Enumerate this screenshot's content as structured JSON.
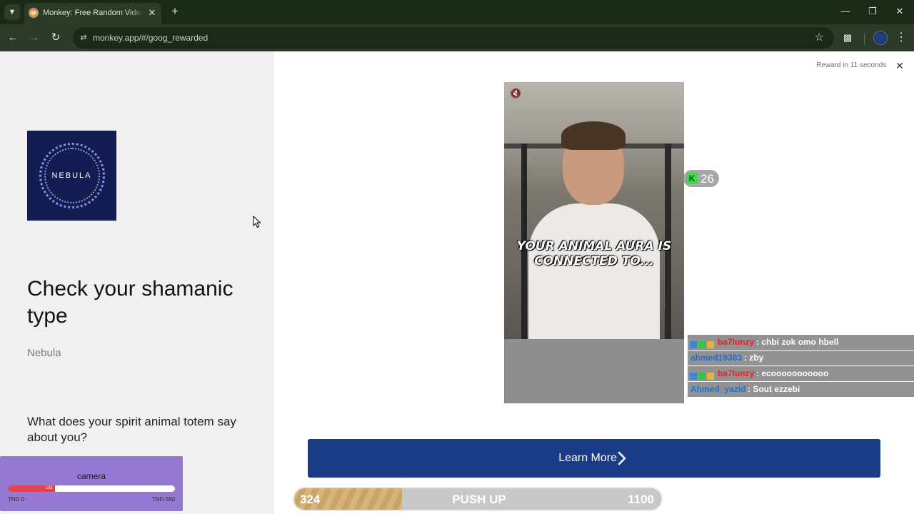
{
  "browser": {
    "tab_title": "Monkey: Free Random Video Chat",
    "url": "monkey.app/#/goog_rewarded"
  },
  "ad_sidebar": {
    "logo_word": "NEBULA",
    "headline": "Check your shamanic type",
    "brand": "Nebula",
    "question": "What does your spirit animal totem say about you?"
  },
  "camera_widget": {
    "title": "camera",
    "current_value": "151",
    "fill_fraction": 0.28,
    "min_label": "TND 0",
    "max_label": "TND 550"
  },
  "ad": {
    "reward_timer": "Reward in 11 seconds",
    "video_caption": "YOUR ANIMAL AURA IS CONNECTED TO...",
    "learn_more": "Learn More"
  },
  "viewer_badge": {
    "count": "26"
  },
  "chat": {
    "messages": [
      {
        "user": "ba7lunzy",
        "text": ": chbi zok omo hbell",
        "user_color": "#e0242c",
        "badges": true
      },
      {
        "user": "ahmed19383",
        "text": ": zby",
        "user_color": "#1e6fd9",
        "badges": false
      },
      {
        "user": "ba7lunzy",
        "text": ": ecooooooooooo",
        "user_color": "#e0242c",
        "badges": true
      },
      {
        "user": "Ahmed_yazid",
        "text": ": Sout ezzebi",
        "user_color": "#1e6fd9",
        "badges": false
      }
    ]
  },
  "pushup_bar": {
    "current": "324",
    "label": "PUSH UP",
    "goal": "1100",
    "fill_fraction": 0.2945
  }
}
